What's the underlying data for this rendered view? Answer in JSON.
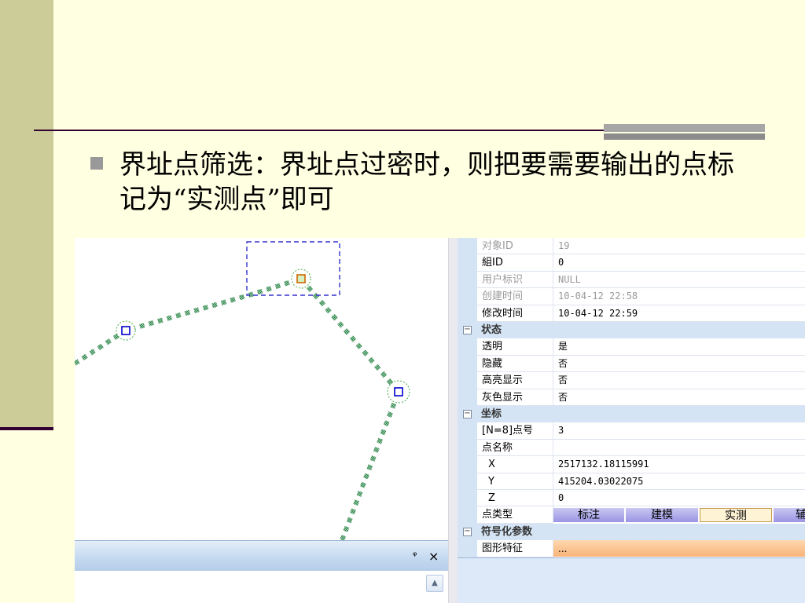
{
  "slide": {
    "bullet_text": "界址点筛选：界址点过密时，则把要需要输出的点标记为“实测点”即可"
  },
  "dock": {
    "pin_glyph": "ᵠ",
    "close_glyph": "×"
  },
  "properties": {
    "rows_top": [
      {
        "key": "对象ID",
        "value": "19",
        "dim": true
      },
      {
        "key": "組ID",
        "value": "0",
        "dim": false
      },
      {
        "key": "用户标识",
        "value": "NULL",
        "dim": true
      },
      {
        "key": "创建时间",
        "value": "10-04-12 22:58",
        "dim": true
      },
      {
        "key": "修改时间",
        "value": "10-04-12 22:59",
        "dim": false
      }
    ],
    "category_state": "状态",
    "rows_state": [
      {
        "key": "透明",
        "value": "是"
      },
      {
        "key": "隐藏",
        "value": "否"
      },
      {
        "key": "高亮显示",
        "value": "否"
      },
      {
        "key": "灰色显示",
        "value": "否"
      }
    ],
    "category_coord": "坐标",
    "rows_coord": [
      {
        "key": "[N=8]点号",
        "value": "3"
      },
      {
        "key": "点名称",
        "value": ""
      },
      {
        "key": "X",
        "value": "2517132.18115991"
      },
      {
        "key": "Y",
        "value": "415204.03022075"
      },
      {
        "key": "Z",
        "value": "0"
      }
    ],
    "point_type_key": "点类型",
    "point_types": [
      "标注",
      "建模",
      "实测",
      "辅"
    ],
    "point_type_selected": "实测",
    "category_symbol": "符号化参数",
    "feature_key": "图形特征",
    "feature_value": "..."
  },
  "colors": {
    "path": "#3a8a55",
    "vertex_marker": "#0000cc",
    "selected_marker": "#cc6600",
    "selection_box": "#3333cc"
  }
}
